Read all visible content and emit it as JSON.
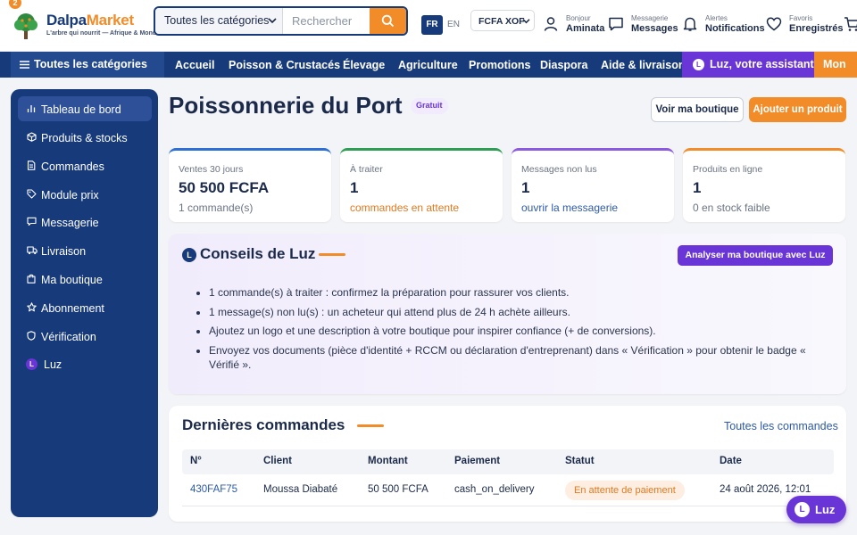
{
  "header": {
    "cart_count": "2",
    "brand_part1": "Dalpa",
    "brand_part2": "Market",
    "tagline": "L'arbre qui nourrit — Afrique & Monde",
    "category_select": "Toutes les catégories",
    "search_placeholder": "Rechercher",
    "lang_fr": "FR",
    "lang_en": "EN",
    "currency": "FCFA XOF",
    "account": {
      "small": "Bonjour",
      "big": "Aminata"
    },
    "messages": {
      "small": "Messagerie",
      "big": "Messages"
    },
    "alerts": {
      "small": "Alertes",
      "big": "Notifications"
    },
    "favorites": {
      "small": "Favoris",
      "big": "Enregistrés"
    }
  },
  "nav": {
    "all_categories": "Toutes les catégories",
    "links": [
      "Accueil",
      "Poisson & Crustacés",
      "Élevage",
      "Agriculture",
      "Promotions",
      "Diaspora",
      "Aide & livraison"
    ],
    "luz": "Luz, votre assistante",
    "luz_letter": "L",
    "more": "Mon"
  },
  "sidebar": {
    "items": [
      {
        "label": "Tableau de bord",
        "icon": "chart-bar-icon"
      },
      {
        "label": "Produits & stocks",
        "icon": "box-icon"
      },
      {
        "label": "Commandes",
        "icon": "document-icon"
      },
      {
        "label": "Module prix",
        "icon": "tag-icon"
      },
      {
        "label": "Messagerie",
        "icon": "chat-icon"
      },
      {
        "label": "Livraison",
        "icon": "truck-icon"
      },
      {
        "label": "Ma boutique",
        "icon": "shop-bag-icon"
      },
      {
        "label": "Abonnement",
        "icon": "star-icon"
      },
      {
        "label": "Vérification",
        "icon": "shield-icon"
      },
      {
        "label": "Luz",
        "icon": "luz-avatar-icon",
        "letter": "L"
      }
    ]
  },
  "main": {
    "title": "Poissonnerie du Port",
    "plan": "Gratuit",
    "view_shop": "Voir ma boutique",
    "add_product": "Ajouter un produit",
    "stats": [
      {
        "label": "Ventes 30 jours",
        "value": "50 500 FCFA",
        "sub": "1 commande(s)",
        "accent": "#2d6fd6",
        "sub_color": "#6b7385"
      },
      {
        "label": "À traiter",
        "value": "1",
        "sub": "commandes en attente",
        "accent": "#2e9e55",
        "sub_color": "#e07a1f"
      },
      {
        "label": "Messages non lus",
        "value": "1",
        "sub": "ouvrir la messagerie",
        "accent": "#8a5be0",
        "sub_color": "#2d5aa8"
      },
      {
        "label": "Produits en ligne",
        "value": "1",
        "sub": "0 en stock faible",
        "accent": "#f28c28",
        "sub_color": "#6b7385"
      }
    ],
    "tips": {
      "title": "Conseils de Luz",
      "letter": "L",
      "analyze_button": "Analyser ma boutique avec Luz",
      "items": [
        "1 commande(s) à traiter : confirmez la préparation pour rassurer vos clients.",
        "1 message(s) non lu(s) : un acheteur qui attend plus de 24 h achète ailleurs.",
        "Ajoutez un logo et une description à votre boutique pour inspirer confiance (+ de conversions).",
        "Envoyez vos documents (pièce d'identité + RCCM ou déclaration d'entreprenant) dans « Vérification » pour obtenir le badge « Vérifié »."
      ]
    },
    "orders": {
      "title": "Dernières commandes",
      "all_link": "Toutes les commandes",
      "columns": [
        "N°",
        "Client",
        "Montant",
        "Paiement",
        "Statut",
        "Date"
      ],
      "rows": [
        {
          "id": "430FAF75",
          "client": "Moussa Diabaté",
          "amount": "50 500 FCFA",
          "payment": "cash_on_delivery",
          "status": "En attente de paiement",
          "date": "24 août 2026, 12:01"
        }
      ]
    }
  },
  "fab": {
    "letter": "L",
    "label": "Luz"
  },
  "colors": {
    "navy": "#173a7a",
    "orange": "#f28c28",
    "purple": "#6a35d6"
  }
}
